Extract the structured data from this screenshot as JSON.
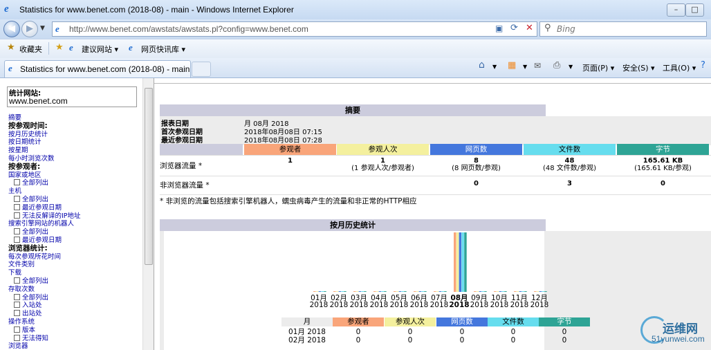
{
  "window": {
    "title": "Statistics for www.benet.com (2018-08) - main - Windows Internet Explorer",
    "min": "–",
    "max": "□",
    "close": "✕"
  },
  "address": {
    "url": "http://www.benet.com/awstats/awstats.pl?config=www.benet.com",
    "search_placeholder": "Bing"
  },
  "favorites": {
    "label": "收藏夹",
    "items": [
      "建议网站 ▾",
      "网页快讯库 ▾"
    ]
  },
  "tab": {
    "title": "Statistics for www.benet.com (2018-08) - main"
  },
  "commands": [
    "页面(P) ▾",
    "安全(S) ▾",
    "工具(O) ▾"
  ],
  "sidebar": {
    "site_label": "统计网站:",
    "site_value": "www.benet.com",
    "items": [
      {
        "t": "摘要",
        "k": "ml"
      },
      {
        "t": "按参观时间:",
        "k": "mh"
      },
      {
        "t": "按月历史统计",
        "k": "ml"
      },
      {
        "t": "按日期统计",
        "k": "ml"
      },
      {
        "t": "按星期",
        "k": "ml"
      },
      {
        "t": "每小时浏览次数",
        "k": "ml"
      },
      {
        "t": "按参观者:",
        "k": "mh"
      },
      {
        "t": "国家或地区",
        "k": "ml"
      },
      {
        "t": "全部列出",
        "k": "ms"
      },
      {
        "t": "主机",
        "k": "ml"
      },
      {
        "t": "全部列出",
        "k": "ms"
      },
      {
        "t": "最近参观日期",
        "k": "ms"
      },
      {
        "t": "无法反解译的IP地址",
        "k": "ms"
      },
      {
        "t": "搜索引擎网站的机器人",
        "k": "ml"
      },
      {
        "t": "全部列出",
        "k": "ms"
      },
      {
        "t": "最近参观日期",
        "k": "ms"
      },
      {
        "t": "浏览器统计:",
        "k": "mh"
      },
      {
        "t": "每次参观所花时间",
        "k": "ml"
      },
      {
        "t": "文件类别",
        "k": "ml"
      },
      {
        "t": "下载",
        "k": "ml"
      },
      {
        "t": "全部列出",
        "k": "ms"
      },
      {
        "t": "存取次数",
        "k": "ml"
      },
      {
        "t": "全部列出",
        "k": "ms"
      },
      {
        "t": "入站处",
        "k": "ms"
      },
      {
        "t": "出站处",
        "k": "ms"
      },
      {
        "t": "操作系统",
        "k": "ml"
      },
      {
        "t": "版本",
        "k": "ms"
      },
      {
        "t": "无法得知",
        "k": "ms"
      },
      {
        "t": "浏览器",
        "k": "ml"
      }
    ]
  },
  "summary": {
    "title": "摘要",
    "report_date_label": "报表日期",
    "report_date": "月 08月 2018",
    "first_visit_label": "首次参观日期",
    "first_visit": "2018年08月08日 07:15",
    "last_visit_label": "最近参观日期",
    "last_visit": "2018年08月08日 07:28",
    "columns": [
      "参观者",
      "参观人次",
      "网页数",
      "文件数",
      "字节"
    ],
    "col_colors": [
      "#f9a57a",
      "#f4f09e",
      "#4477dd",
      "#66ddee",
      "#2ea495"
    ],
    "rows": [
      {
        "label": "浏览器流量 *",
        "values": [
          "1",
          "1",
          "8",
          "48",
          "165.61 KB"
        ],
        "subs": [
          "",
          "(1 参观人次/参观者)",
          "(8 网页数/参观)",
          "(48 文件数/参观)",
          "(165.61 KB/参观)"
        ]
      },
      {
        "label": "非浏览器流量 *",
        "values": [
          "",
          "",
          "0",
          "3",
          "0"
        ],
        "subs": [
          "",
          "",
          "",
          "",
          ""
        ]
      }
    ],
    "note": "* 非浏览的流量包括搜索引擎机器人，蠕虫病毒产生的流量和非正常的HTTP相应"
  },
  "monthly": {
    "title": "按月历史统计",
    "months": [
      "01月",
      "02月",
      "03月",
      "04月",
      "05月",
      "06月",
      "07月",
      "08月",
      "09月",
      "10月",
      "11月",
      "12月"
    ],
    "year": "2018",
    "active_month_index": 7,
    "table_header": [
      "月",
      "参观者",
      "参观人次",
      "网页数",
      "文件数",
      "字节"
    ],
    "table_rows": [
      [
        "01月 2018",
        "0",
        "0",
        "0",
        "0",
        "0"
      ],
      [
        "02月 2018",
        "0",
        "0",
        "0",
        "0",
        "0"
      ]
    ]
  },
  "chart_data": {
    "type": "bar",
    "categories": [
      "01月 2018",
      "02月 2018",
      "03月 2018",
      "04月 2018",
      "05月 2018",
      "06月 2018",
      "07月 2018",
      "08月 2018",
      "09月 2018",
      "10月 2018",
      "11月 2018",
      "12月 2018"
    ],
    "series": [
      {
        "name": "参观者",
        "values": [
          0,
          0,
          0,
          0,
          0,
          0,
          0,
          1,
          0,
          0,
          0,
          0
        ],
        "color": "#f9a57a"
      },
      {
        "name": "参观人次",
        "values": [
          0,
          0,
          0,
          0,
          0,
          0,
          0,
          1,
          0,
          0,
          0,
          0
        ],
        "color": "#f4f09e"
      },
      {
        "name": "网页数",
        "values": [
          0,
          0,
          0,
          0,
          0,
          0,
          0,
          8,
          0,
          0,
          0,
          0
        ],
        "color": "#4477dd"
      },
      {
        "name": "文件数",
        "values": [
          0,
          0,
          0,
          0,
          0,
          0,
          0,
          48,
          0,
          0,
          0,
          0
        ],
        "color": "#66ddee"
      },
      {
        "name": "字节",
        "values": [
          0,
          0,
          0,
          0,
          0,
          0,
          0,
          165.61,
          0,
          0,
          0,
          0
        ],
        "color": "#2ea495"
      }
    ]
  },
  "watermark": {
    "site": "运维网",
    "url": "51yunwei.com"
  }
}
